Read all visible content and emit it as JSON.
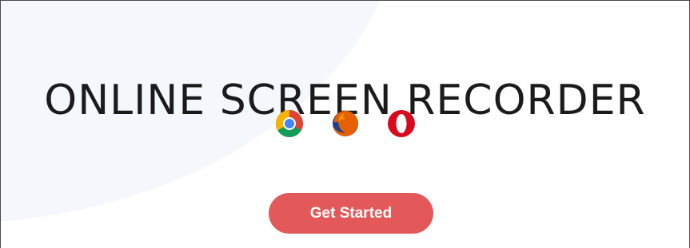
{
  "hero": {
    "title": "ONLINE SCREEN RECORDER",
    "cta_label": "Get Started"
  },
  "browsers": [
    {
      "icon": "chrome-icon"
    },
    {
      "icon": "firefox-icon"
    },
    {
      "icon": "opera-icon"
    }
  ],
  "colors": {
    "cta_background": "#e35858",
    "title_text": "#1b1b1b",
    "background_blob": "#f4f7fc"
  }
}
